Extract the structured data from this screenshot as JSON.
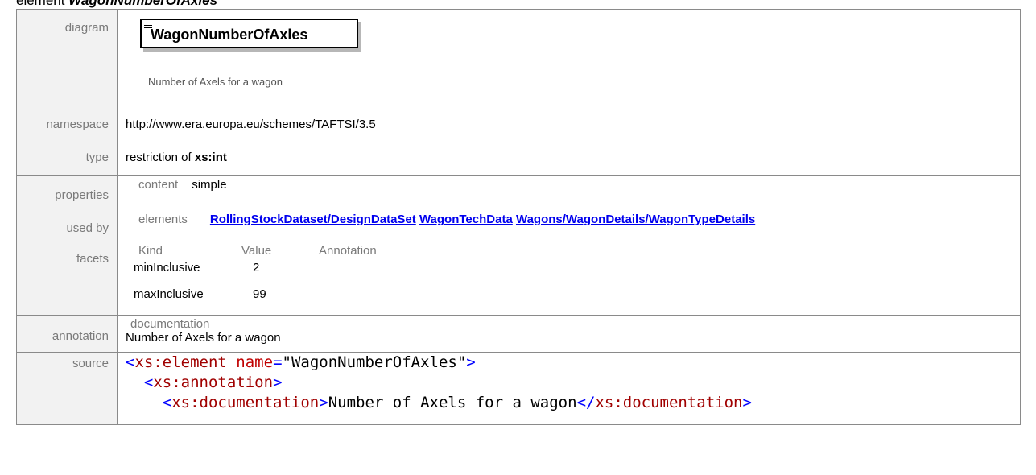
{
  "heading": {
    "prefix": "element ",
    "name": "WagonNumberOfAxles"
  },
  "diagram": {
    "label": "diagram",
    "element_name": "WagonNumberOfAxles",
    "documentation": "Number of Axels for a wagon"
  },
  "namespace": {
    "label": "namespace",
    "value": "http://www.era.europa.eu/schemes/TAFTSI/3.5"
  },
  "type": {
    "label": "type",
    "prefix": "restriction of ",
    "base": "xs:int"
  },
  "properties": {
    "label": "properties",
    "key": "content",
    "value": "simple"
  },
  "used_by": {
    "label": "used by",
    "key": "elements",
    "links": [
      "RollingStockDataset/DesignDataSet",
      "WagonTechData",
      "Wagons/WagonDetails/WagonTypeDetails"
    ]
  },
  "facets": {
    "label": "facets",
    "headers": [
      "Kind",
      "Value",
      "Annotation"
    ],
    "rows": [
      {
        "kind": "minInclusive",
        "value": "2"
      },
      {
        "kind": "maxInclusive",
        "value": "99"
      }
    ]
  },
  "annotation": {
    "label": "annotation",
    "key": "documentation",
    "value": "Number of Axels for a wagon"
  },
  "source": {
    "label": "source",
    "line1": {
      "tag": "xs:element",
      "attr": "name",
      "attrval": "\"WagonNumberOfAxles\""
    },
    "line2": {
      "tag": "xs:annotation"
    },
    "line3": {
      "tag": "xs:documentation",
      "text": "Number of Axels for a wagon",
      "closetag": "xs:documentation"
    }
  }
}
